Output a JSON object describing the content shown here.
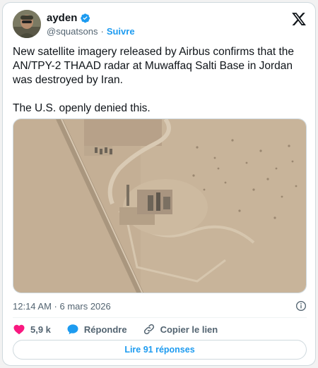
{
  "author": {
    "display_name": "ayden",
    "handle": "@squatsons",
    "separator": "·",
    "follow_label": "Suivre"
  },
  "tweet": {
    "paragraph_1": "New satellite imagery released by Airbus confirms that the AN/TPY-2 THAAD radar at Muwaffaq Salti Base in Jordan was destroyed by Iran.",
    "paragraph_2": "The U.S. openly denied this."
  },
  "meta": {
    "timestamp": "12:14 AM · 6 mars 2026"
  },
  "actions": {
    "like_count": "5,9 k",
    "reply_label": "Répondre",
    "copy_link_label": "Copier le lien"
  },
  "replies_button": {
    "label": "Lire 91 réponses"
  },
  "colors": {
    "accent": "#1d9bf0",
    "like": "#f91880",
    "text_secondary": "#536471"
  },
  "icons": {
    "verified": "verified-badge-icon",
    "platform": "x-logo-icon",
    "info": "info-icon",
    "like": "heart-icon",
    "reply": "speech-bubble-icon",
    "copy_link": "link-icon"
  }
}
